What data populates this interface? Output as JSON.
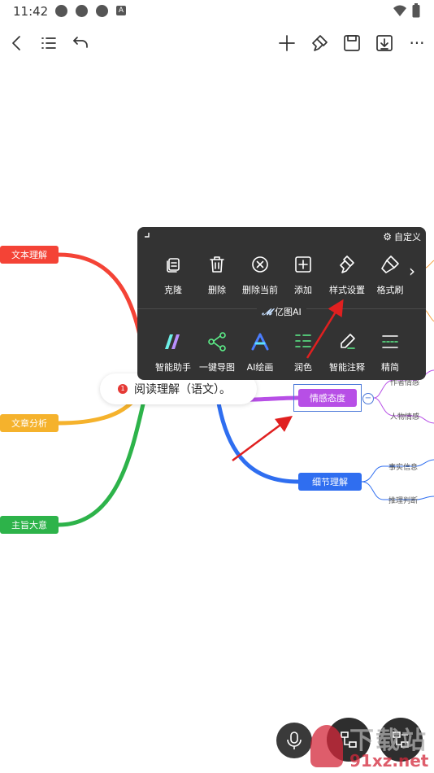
{
  "status": {
    "time": "11:42",
    "a_badge": "A"
  },
  "toolbar": {
    "more": "···"
  },
  "mindmap": {
    "root": "阅读理解（语文）。",
    "root_badge": "1",
    "left_nodes": [
      {
        "label": "文本理解",
        "color": "#f44336"
      },
      {
        "label": "文章分析",
        "color": "#f5b22c"
      },
      {
        "label": "主旨大意",
        "color": "#2db34a"
      }
    ],
    "right_nodes": [
      {
        "label": "情感态度",
        "color": "#b74fe6"
      },
      {
        "label": "细节理解",
        "color": "#2f6ef0"
      }
    ],
    "emotion_children": [
      "作者情感",
      "人物情感"
    ],
    "detail_children": [
      "事实信息",
      "推理判断"
    ],
    "collapse_symbol": "−"
  },
  "popup": {
    "customize": "自定义",
    "ai_title": "亿图AI",
    "row1": [
      "克隆",
      "删除",
      "删除当前",
      "添加",
      "样式设置",
      "格式刷"
    ],
    "row2": [
      "智能助手",
      "一键导图",
      "AI绘画",
      "润色",
      "智能注释",
      "精简"
    ],
    "next_arrow": "›"
  },
  "watermark": {
    "text1": "下载站",
    "text2": "91xz.net"
  }
}
